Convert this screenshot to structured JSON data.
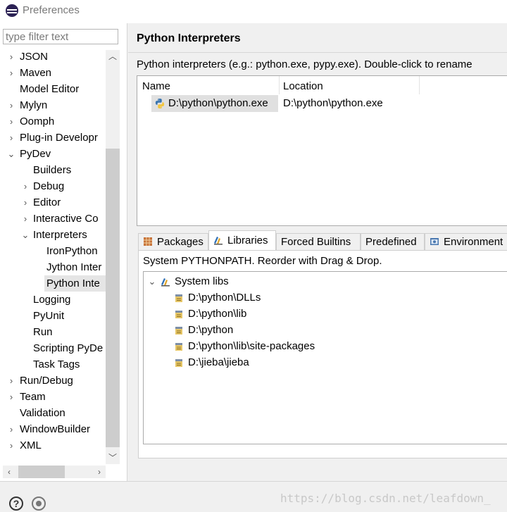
{
  "window": {
    "title": "Preferences"
  },
  "filter": {
    "placeholder": "type filter text"
  },
  "tree": [
    {
      "label": "JSON",
      "expandable": true
    },
    {
      "label": "Maven",
      "expandable": true
    },
    {
      "label": "Model Editor",
      "expandable": false
    },
    {
      "label": "Mylyn",
      "expandable": true
    },
    {
      "label": "Oomph",
      "expandable": true
    },
    {
      "label": "Plug-in Developr",
      "expandable": true
    },
    {
      "label": "PyDev",
      "expanded": true
    },
    {
      "label": "Builders",
      "expandable": false
    },
    {
      "label": "Debug",
      "expandable": true
    },
    {
      "label": "Editor",
      "expandable": true
    },
    {
      "label": "Interactive Co",
      "expandable": true
    },
    {
      "label": "Interpreters",
      "expanded": true
    },
    {
      "label": "IronPython",
      "expandable": false
    },
    {
      "label": "Jython Inter",
      "expandable": false
    },
    {
      "label": "Python Inte",
      "expandable": false,
      "selected": true
    },
    {
      "label": "Logging",
      "expandable": false
    },
    {
      "label": "PyUnit",
      "expandable": false
    },
    {
      "label": "Run",
      "expandable": false
    },
    {
      "label": "Scripting PyDe",
      "expandable": false
    },
    {
      "label": "Task Tags",
      "expandable": false
    },
    {
      "label": "Run/Debug",
      "expandable": true
    },
    {
      "label": "Team",
      "expandable": true
    },
    {
      "label": "Validation",
      "expandable": false
    },
    {
      "label": "WindowBuilder",
      "expandable": true
    },
    {
      "label": "XML",
      "expandable": true
    }
  ],
  "page": {
    "title": "Python Interpreters",
    "description": "Python interpreters (e.g.: python.exe, pypy.exe).   Double-click to rename"
  },
  "interpreters": {
    "columns": [
      "Name",
      "Location"
    ],
    "rows": [
      {
        "name": "D:\\python\\python.exe",
        "location": "D:\\python\\python.exe"
      }
    ]
  },
  "tabs": [
    "Packages",
    "Libraries",
    "Forced Builtins",
    "Predefined",
    "Environment"
  ],
  "active_tab": "Libraries",
  "libraries": {
    "description": "System PYTHONPATH.   Reorder with Drag & Drop.",
    "root": "System libs",
    "items": [
      "D:\\python\\DLLs",
      "D:\\python\\lib",
      "D:\\python",
      "D:\\python\\lib\\site-packages",
      "D:\\jieba\\jieba"
    ]
  },
  "watermark": "https://blog.csdn.net/leafdown_",
  "colors": {
    "selection": "#e0e0e0",
    "panel_bg": "#f0f0f0",
    "border": "#aaaaaa"
  }
}
